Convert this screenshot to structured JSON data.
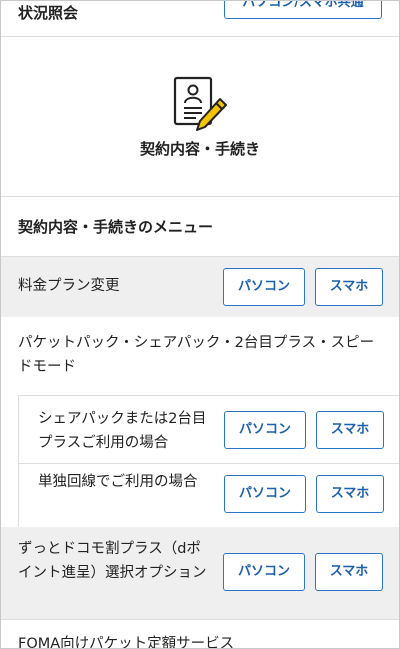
{
  "top_row": {
    "label": "状況照会",
    "button": "パソコン/スマホ共通"
  },
  "hero": {
    "icon": "contract-document-pencil-icon",
    "title": "契約内容・手続き"
  },
  "menu_heading": "契約内容・手続きのメニュー",
  "buttons": {
    "pc": "パソコン",
    "sp": "スマホ"
  },
  "rows": [
    {
      "label": "料金プラン変更"
    },
    {
      "label": "パケットパック・シェアパック・2台目プラス・スピードモード"
    }
  ],
  "sub_rows": [
    {
      "label": "シェアパックまたは2台目プラスご利用の場合"
    },
    {
      "label": "単独回線でご利用の場合"
    }
  ],
  "row_dpoint": {
    "label": "ずっとドコモ割プラス（dポイント進呈）選択オプション"
  },
  "bottom_row": {
    "label": "FOMA向けパケット定額サービス"
  },
  "colors": {
    "accent": "#1b5fae",
    "button_border": "#2a77c7",
    "row_gray": "#efefef",
    "pencil": "#f4c300"
  }
}
